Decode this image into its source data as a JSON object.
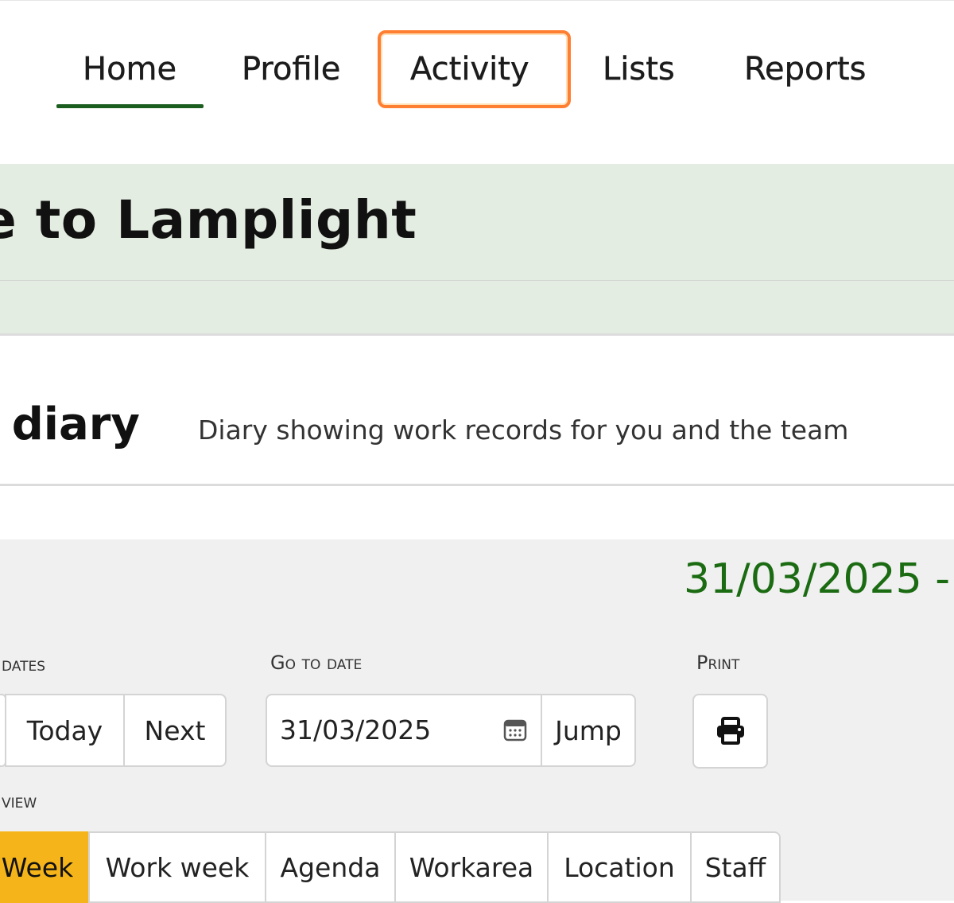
{
  "nav": {
    "items": [
      {
        "label": "Home",
        "active": true
      },
      {
        "label": "Profile"
      },
      {
        "label": "Activity",
        "highlighted": true
      },
      {
        "label": "Lists"
      },
      {
        "label": "Reports"
      }
    ],
    "active_color": "#1b5e20",
    "highlight_color": "#ff7f32"
  },
  "welcome": {
    "title": "e to Lamplight",
    "band_color": "#e4ede1"
  },
  "diary": {
    "title": "i diary",
    "description": "Diary showing work records for you and the team"
  },
  "calendar": {
    "date_range": "31/03/2025 -",
    "date_range_color": "#1b6b12",
    "dates_label": "dates",
    "today_label": "Today",
    "next_label": "Next",
    "goto_label": "Go to date",
    "goto_value": "31/03/2025",
    "jump_label": "Jump",
    "print_label": "Print",
    "view_label": "view",
    "views": [
      {
        "label": "Week",
        "active": true
      },
      {
        "label": "Work week"
      },
      {
        "label": "Agenda"
      },
      {
        "label": "Workarea"
      },
      {
        "label": "Location"
      },
      {
        "label": "Staff"
      }
    ],
    "active_view_color": "#f5b51a"
  },
  "icons": {
    "calendar": "calendar-icon",
    "print": "printer-icon"
  }
}
